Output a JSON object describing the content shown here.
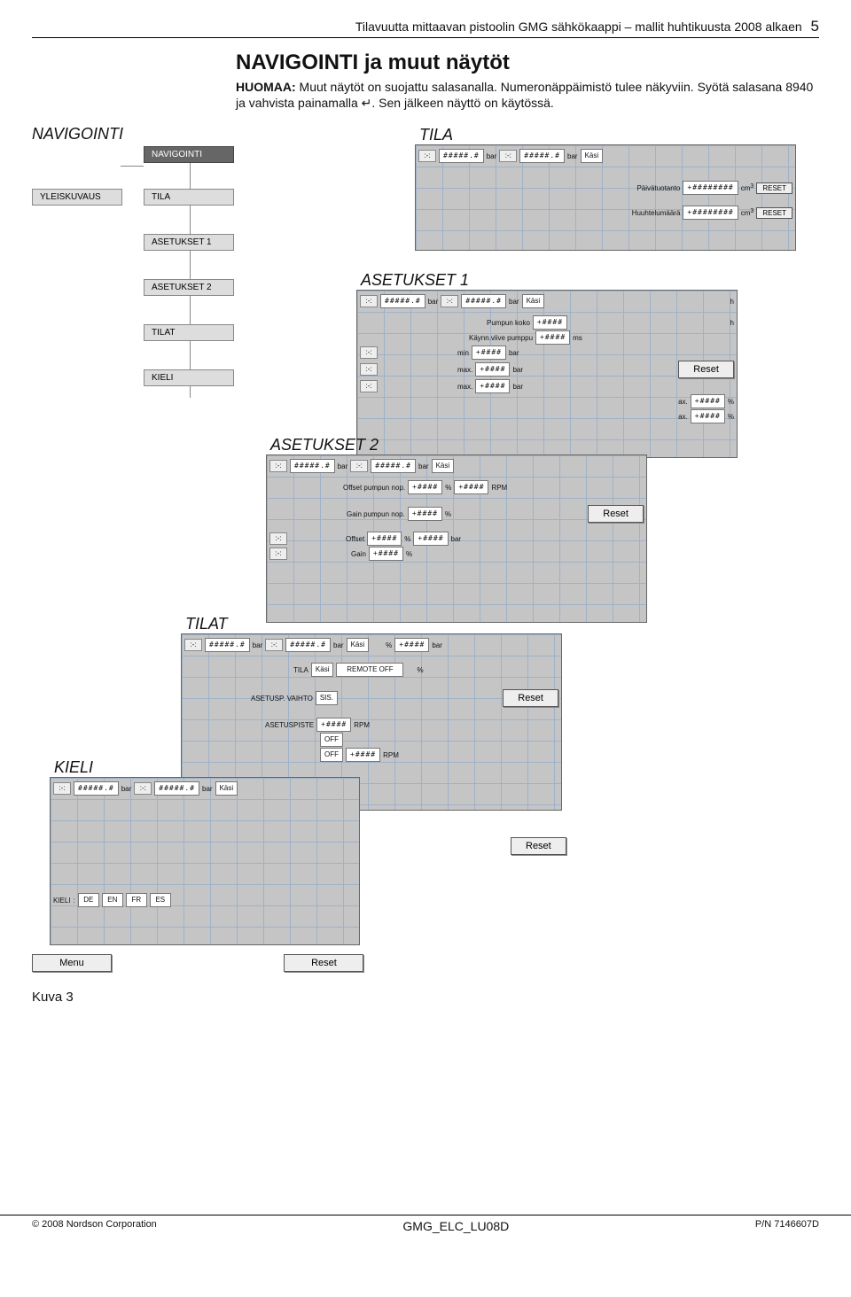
{
  "header": {
    "title": "Tilavuutta mittaavan pistoolin GMG sähkökaappi – mallit huhtikuusta 2008 alkaen",
    "pn": "5"
  },
  "intro": {
    "h": "NAVIGOINTI ja muut näytöt",
    "l1a": "HUOMAA:",
    "l1b": "Muut näytöt on suojattu salasanalla. Numeronäppäimistö tulee näkyviin. Syötä salasana 8940 ja vahvista painamalla ↵. Sen jälkeen näyttö on käytössä."
  },
  "tree": {
    "root": "NAVIGOINTI",
    "navlabel": "NAVIGOINTI",
    "c1": {
      "yleiskuvaus": "YLEISKUVAUS"
    },
    "c2": {
      "tila": "TILA",
      "a1": "ASETUKSET 1",
      "a2": "ASETUKSET 2",
      "tilat": "TILAT",
      "kieli": "KIELI"
    }
  },
  "screens": {
    "tila": {
      "title": "TILA",
      "bar": "bar",
      "kasi": "Käsi",
      "pt": "Päivätuotanto",
      "hm": "Huuhtelumäärä",
      "cm3": "cm",
      "reset": "RESET"
    },
    "a1": {
      "title": "ASETUKSET 1",
      "pk": "Pumpun koko",
      "kv": "Käynn.viive pumppu",
      "ms": "ms",
      "min": "min",
      "max": "max.",
      "bar": "bar",
      "kasi": "Käsi",
      "hh": "h",
      "reset": "Reset",
      "ax": "ax.",
      "pct": "%"
    },
    "a2": {
      "title": "ASETUKSET 2",
      "ofpn": "Offset pumpun nop.",
      "gpn": "Gain pumpun nop.",
      "offset": "Offset",
      "gain": "Gain",
      "pct": "%",
      "rpm": "RPM",
      "bar": "bar",
      "kasi": "Käsi",
      "reset": "Reset"
    },
    "tilat": {
      "title": "TILAT",
      "tila": "TILA",
      "kasi": "Käsi",
      "rem": "REMOTE OFF",
      "asv": "ASETUSP. VAIHTO",
      "sis": "SIS.",
      "asp": "ASETUSPISTE",
      "rpm": "RPM",
      "off": "OFF",
      "bar": "bar",
      "reset": "Reset"
    },
    "kieli": {
      "title": "KIELI",
      "kieli": "KIELI",
      "langs": [
        "DE",
        "EN",
        "FR",
        "ES"
      ],
      "bar": "bar",
      "kasi": "Käsi"
    }
  },
  "bottom": {
    "menu": "Menu",
    "reset": "Reset",
    "kuva": "Kuva 3"
  },
  "footer": {
    "left": "© 2008 Nordson Corporation",
    "mid": "GMG_ELC_LU08D",
    "right": "P/N 7146607D"
  },
  "placeholder": "#####.#",
  "placeholder2": "+####",
  "placeholderlong": "+########"
}
